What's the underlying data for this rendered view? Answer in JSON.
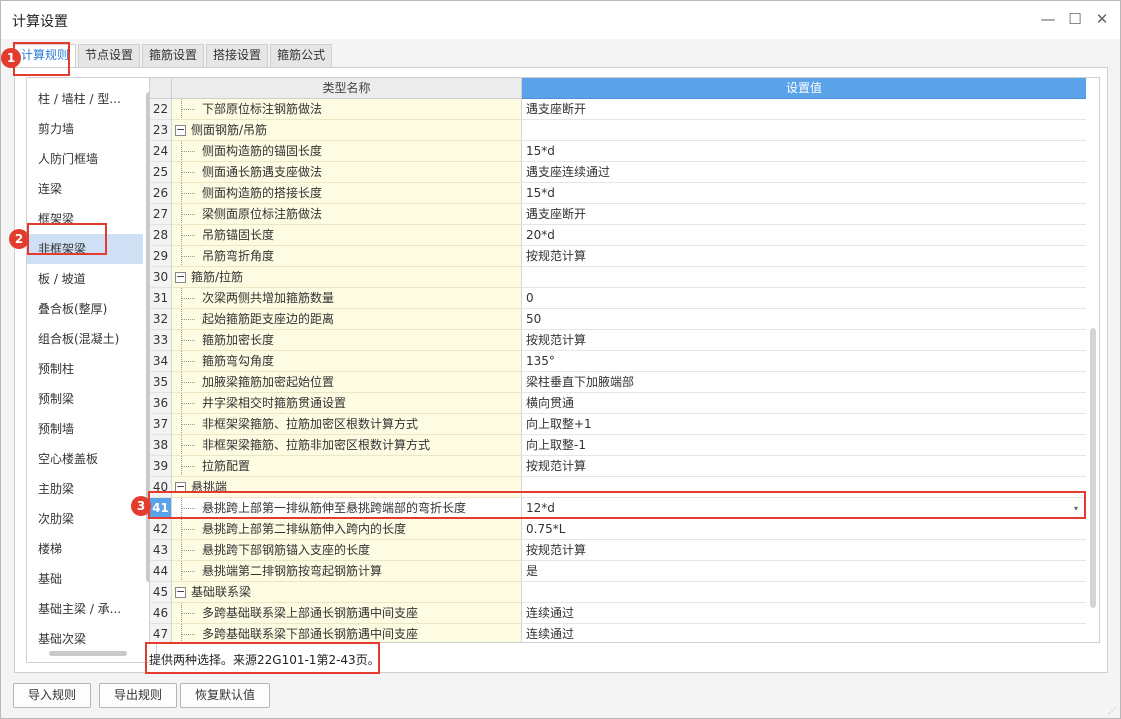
{
  "window": {
    "title": "计算设置",
    "minimize_glyph": "—",
    "maximize_glyph": "☐",
    "close_glyph": "✕"
  },
  "tabs": [
    {
      "label": "计算规则",
      "active": true
    },
    {
      "label": "节点设置",
      "active": false
    },
    {
      "label": "箍筋设置",
      "active": false
    },
    {
      "label": "搭接设置",
      "active": false
    },
    {
      "label": "箍筋公式",
      "active": false
    }
  ],
  "left_list": {
    "items": [
      {
        "label": "柱 / 墙柱 / 型..."
      },
      {
        "label": "剪力墙"
      },
      {
        "label": "人防门框墙"
      },
      {
        "label": "连梁"
      },
      {
        "label": "框架梁"
      },
      {
        "label": "非框架梁",
        "selected": true
      },
      {
        "label": "板 / 坡道"
      },
      {
        "label": "叠合板(整厚)"
      },
      {
        "label": "组合板(混凝土)"
      },
      {
        "label": "预制柱"
      },
      {
        "label": "预制梁"
      },
      {
        "label": "预制墙"
      },
      {
        "label": "空心楼盖板"
      },
      {
        "label": "主肋梁"
      },
      {
        "label": "次肋梁"
      },
      {
        "label": "楼梯"
      },
      {
        "label": "基础"
      },
      {
        "label": "基础主梁 / 承..."
      },
      {
        "label": "基础次梁"
      }
    ]
  },
  "grid": {
    "headers": {
      "name": "类型名称",
      "value": "设置值"
    },
    "rows": [
      {
        "n": "22",
        "name": "下部原位标注钢筋做法",
        "value": "遇支座断开",
        "type": "child"
      },
      {
        "n": "23",
        "name": "侧面钢筋/吊筋",
        "value": "",
        "type": "group"
      },
      {
        "n": "24",
        "name": "侧面构造筋的锚固长度",
        "value": "15*d",
        "type": "child"
      },
      {
        "n": "25",
        "name": "侧面通长筋遇支座做法",
        "value": "遇支座连续通过",
        "type": "child"
      },
      {
        "n": "26",
        "name": "侧面构造筋的搭接长度",
        "value": "15*d",
        "type": "child"
      },
      {
        "n": "27",
        "name": "梁侧面原位标注筋做法",
        "value": "遇支座断开",
        "type": "child"
      },
      {
        "n": "28",
        "name": "吊筋锚固长度",
        "value": "20*d",
        "type": "child"
      },
      {
        "n": "29",
        "name": "吊筋弯折角度",
        "value": "按规范计算",
        "type": "child"
      },
      {
        "n": "30",
        "name": "箍筋/拉筋",
        "value": "",
        "type": "group"
      },
      {
        "n": "31",
        "name": "次梁两侧共增加箍筋数量",
        "value": "0",
        "type": "child"
      },
      {
        "n": "32",
        "name": "起始箍筋距支座边的距离",
        "value": "50",
        "type": "child"
      },
      {
        "n": "33",
        "name": "箍筋加密长度",
        "value": "按规范计算",
        "type": "child"
      },
      {
        "n": "34",
        "name": "箍筋弯勾角度",
        "value": "135°",
        "type": "child"
      },
      {
        "n": "35",
        "name": "加腋梁箍筋加密起始位置",
        "value": "梁柱垂直下加腋端部",
        "type": "child"
      },
      {
        "n": "36",
        "name": "井字梁相交时箍筋贯通设置",
        "value": "横向贯通",
        "type": "child"
      },
      {
        "n": "37",
        "name": "非框架梁箍筋、拉筋加密区根数计算方式",
        "value": "向上取整+1",
        "type": "child"
      },
      {
        "n": "38",
        "name": "非框架梁箍筋、拉筋非加密区根数计算方式",
        "value": "向上取整-1",
        "type": "child"
      },
      {
        "n": "39",
        "name": "拉筋配置",
        "value": "按规范计算",
        "type": "child"
      },
      {
        "n": "40",
        "name": "悬挑端",
        "value": "",
        "type": "group"
      },
      {
        "n": "41",
        "name": "悬挑跨上部第一排纵筋伸至悬挑跨端部的弯折长度",
        "value": "12*d",
        "type": "child",
        "selected": true
      },
      {
        "n": "42",
        "name": "悬挑跨上部第二排纵筋伸入跨内的长度",
        "value": "0.75*L",
        "type": "child"
      },
      {
        "n": "43",
        "name": "悬挑跨下部钢筋锚入支座的长度",
        "value": "按规范计算",
        "type": "child"
      },
      {
        "n": "44",
        "name": "悬挑端第二排钢筋按弯起钢筋计算",
        "value": "是",
        "type": "child"
      },
      {
        "n": "45",
        "name": "基础联系梁",
        "value": "",
        "type": "group"
      },
      {
        "n": "46",
        "name": "多跨基础联系梁上部通长钢筋遇中间支座",
        "value": "连续通过",
        "type": "child"
      },
      {
        "n": "47",
        "name": "多跨基础联系梁下部通长钢筋遇中间支座",
        "value": "连续通过",
        "type": "child"
      }
    ]
  },
  "description": "提供两种选择。来源22G101-1第2-43页。",
  "buttons": {
    "import": "导入规则",
    "export": "导出规则",
    "reset": "恢复默认值"
  },
  "markers": [
    "1",
    "2",
    "3"
  ],
  "icons": {
    "collapse": "−",
    "dropdown": "▾",
    "resize_grip": "⋰"
  },
  "colors": {
    "accent": "#5aa3e8",
    "highlight": "#e33b2e",
    "name_cell": "#fdfbe2",
    "selected_item": "#cfe0f4"
  }
}
